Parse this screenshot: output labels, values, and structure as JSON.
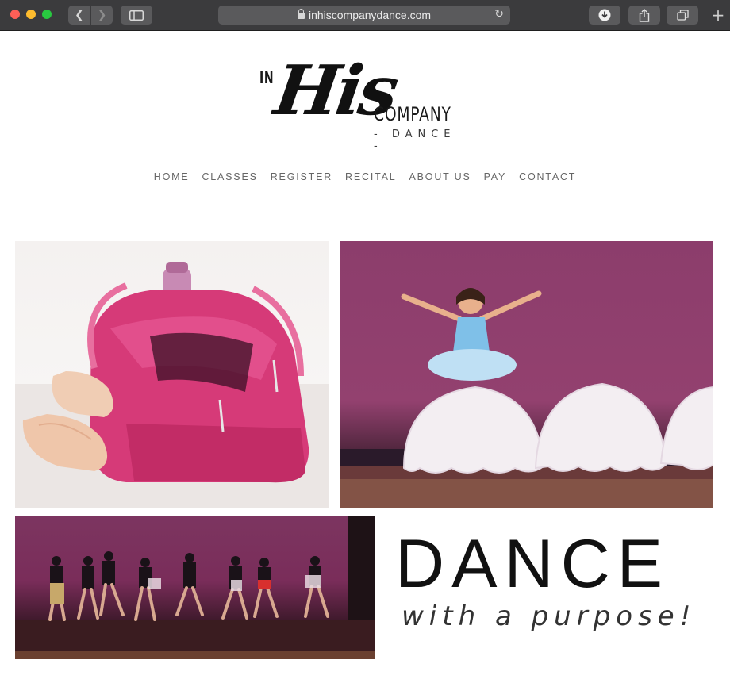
{
  "browser": {
    "url": "inhiscompanydance.com",
    "back_icon": "chevron-left-icon",
    "forward_icon": "chevron-right-icon",
    "sidebar_icon": "sidebar-icon",
    "lock_icon": "lock-icon",
    "reload_icon": "reload-icon",
    "download_icon": "download-icon",
    "share_icon": "share-icon",
    "tabs_icon": "tabs-icon",
    "new_tab_icon": "plus-icon"
  },
  "logo": {
    "in": "IN",
    "his": "His",
    "company": "COMPANY",
    "dance": "- DANCE -"
  },
  "nav": {
    "items": [
      {
        "label": "HOME"
      },
      {
        "label": "CLASSES"
      },
      {
        "label": "REGISTER"
      },
      {
        "label": "RECITAL"
      },
      {
        "label": "ABOUT US"
      },
      {
        "label": "PAY"
      },
      {
        "label": "CONTACT"
      }
    ]
  },
  "hero": {
    "headline": "DANCE",
    "tagline": "with a purpose!"
  },
  "colors": {
    "chrome": "#3b3b3d",
    "nav_text": "#666666",
    "stage_magenta": "#8c3d6c",
    "bag_pink": "#d63a78"
  }
}
